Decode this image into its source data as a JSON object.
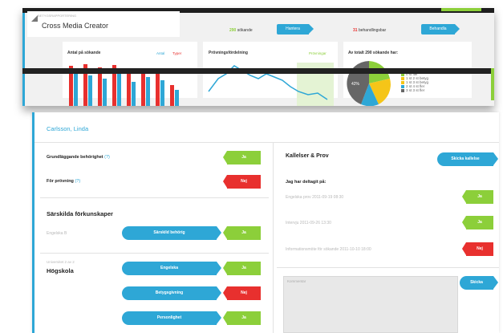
{
  "dashboard": {
    "app_subtitle": "BETYGSRAPPORTERING",
    "app_title": "Cross Media Creator",
    "stat1": {
      "number": "290",
      "label": "sökande"
    },
    "stat1_button": "Hantera",
    "stat2": {
      "number": "31",
      "label": "behandlingsbar"
    },
    "stat2_button": "Behandla",
    "panel1": {
      "title": "Antal på sökande",
      "legend_a": "Antal",
      "legend_b": "Typer",
      "colors": {
        "red": "#e8302e",
        "blue": "#2ea7d6"
      }
    },
    "panel2": {
      "title": "Prövningsfördelning",
      "legend": "Prövningar"
    },
    "panel3": {
      "title": "Av totalt 290 sökande har:",
      "pie_label": "42%",
      "legend": [
        "0 st fler",
        "1 st 2 st betyg",
        "1 st 3 st betyg",
        "2 st 4 st fler",
        "3 st 3 st fler"
      ]
    }
  },
  "card": {
    "name": "Carlsson, Linda",
    "left": {
      "rows": [
        {
          "label": "Grundläggande behörighet",
          "hint": "(?)",
          "answer": "Ja"
        },
        {
          "label": "För prövning",
          "hint": "(?)",
          "answer": "Nej"
        }
      ],
      "section1_title": "Särskilda förkunskaper",
      "section1_muted": "Engelska B",
      "section1_button": "Särskild behörig",
      "section1_answer": "Ja",
      "section2_muted": "Universitet 2 av 2",
      "section2_title": "Högskola",
      "buttons": [
        {
          "label": "Engelska",
          "answer": "Ja"
        },
        {
          "label": "Betygsgivning",
          "answer": "Nej"
        },
        {
          "label": "Personlighet",
          "answer": "Ja"
        }
      ]
    },
    "right": {
      "title": "Kallelser & Prov",
      "send_button": "Skicka kallelse",
      "subtitle": "Jag har deltagit på:",
      "events": [
        {
          "label": "Engelska prov 2011-09-19 08:30",
          "answer": "Ja"
        },
        {
          "label": "Intervju 2011-09-26 13:30",
          "answer": "Ja"
        },
        {
          "label": "Informationsmöte för sökande 2011-10-10 18:00",
          "answer": "Nej"
        }
      ],
      "comment_placeholder": "Kommentar",
      "save_button": "Skicka"
    },
    "colors": {
      "accent": "#2ea7d6",
      "yes": "#8ccf3a",
      "no": "#e8302e"
    }
  }
}
